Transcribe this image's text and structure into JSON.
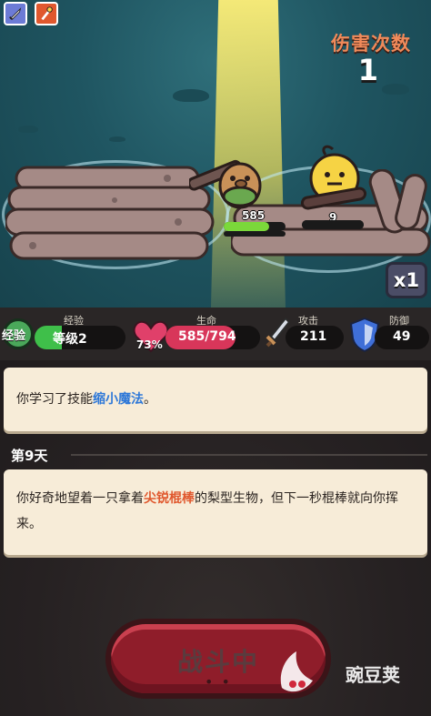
{
  "header": {
    "damage_title": "伤害次数",
    "damage_count": "1",
    "speed_label": "x1"
  },
  "skills": [
    {
      "name": "sword-skill-icon",
      "color": "#6c7bd6"
    },
    {
      "name": "torch-skill-icon",
      "color": "#e0582e"
    }
  ],
  "player": {
    "hp_text": "585",
    "hp_fraction": 0.74
  },
  "enemy": {
    "hp_text": "9",
    "hp_fraction": 1.0
  },
  "stats": {
    "exp": {
      "badge": "经验",
      "label": "经验",
      "value": "等级2",
      "fraction": 0.3
    },
    "life": {
      "label": "生命",
      "percent": "73%",
      "value": "585/794",
      "fraction": 0.74
    },
    "attack": {
      "label": "攻击",
      "value": "211"
    },
    "defense": {
      "label": "防御",
      "value": "49"
    }
  },
  "log": {
    "entry1": {
      "prefix": "你学习了技能",
      "keyword": "缩小魔法",
      "suffix": "。"
    },
    "day_label": "第9天",
    "entry2": {
      "prefix": "你好奇地望着一只拿着",
      "keyword": "尖锐棍棒",
      "suffix": "的梨型生物，但下一秒棍棒就向你挥来。"
    }
  },
  "battle_button": {
    "label": "战斗中",
    "dots": "• •"
  },
  "watermark": {
    "text": "豌豆荚"
  },
  "colors": {
    "water": "#1f5561",
    "accent_red": "#e0582e",
    "keyword_blue": "#2e78d8",
    "card_bg": "#f7ecd8"
  }
}
